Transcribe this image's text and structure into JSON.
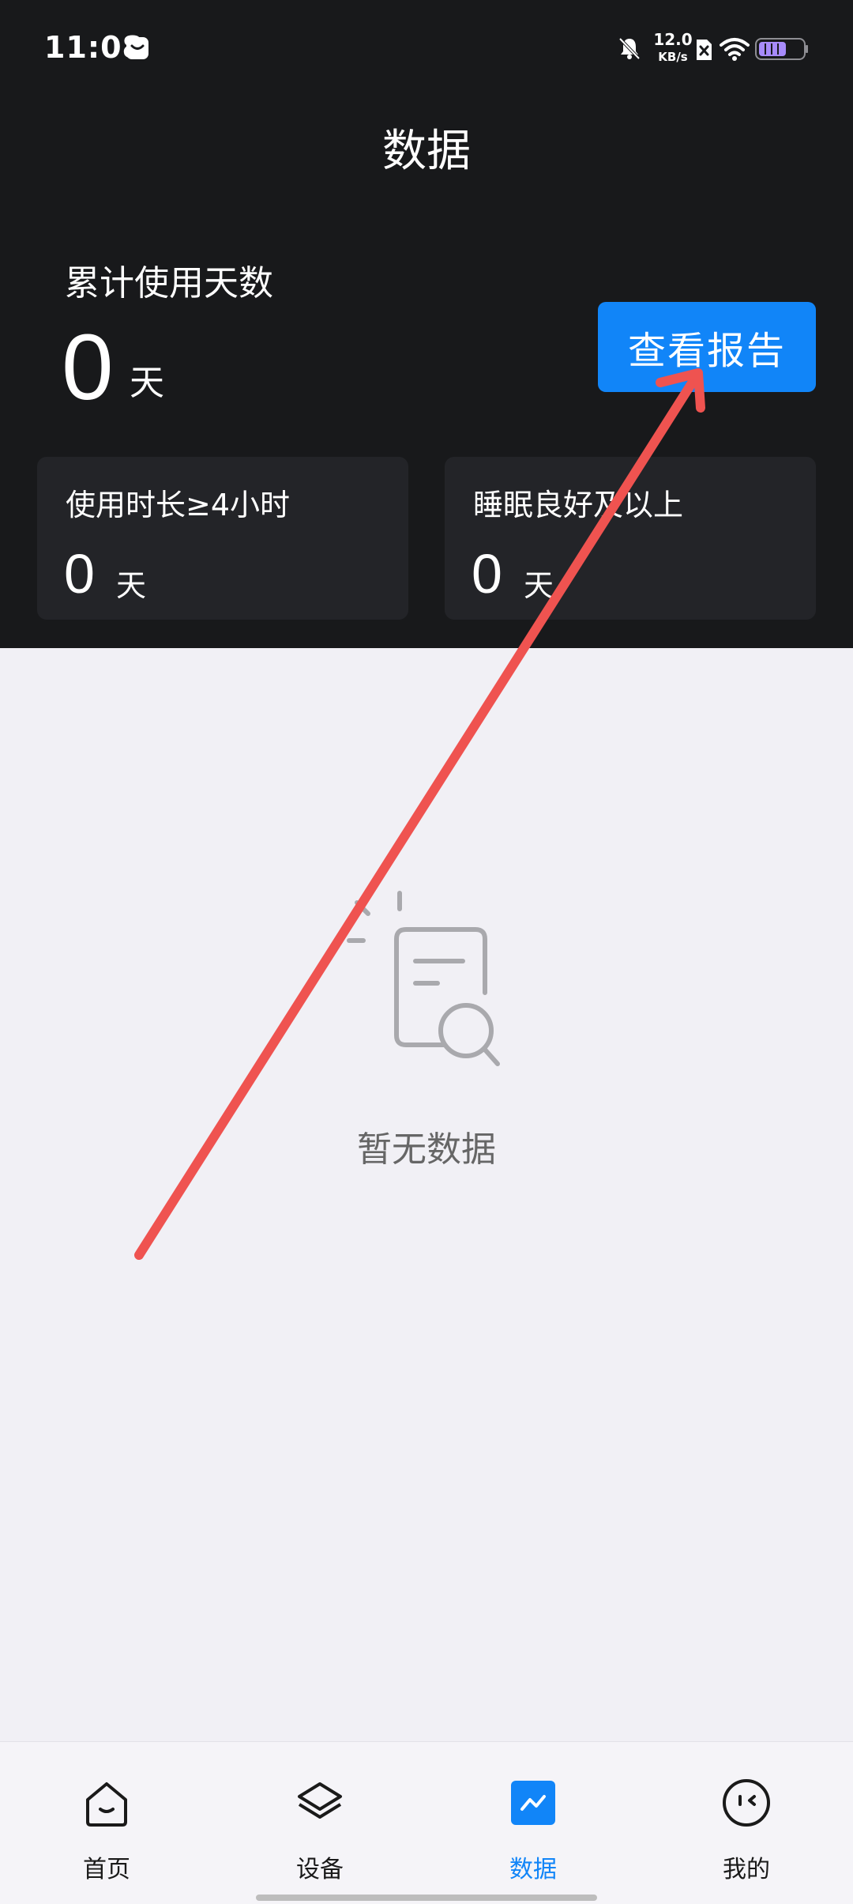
{
  "status_bar": {
    "time": "11:08",
    "net_speed_value": "12.0",
    "net_speed_unit": "KB/s",
    "icons": [
      "message-icon",
      "bell-muted-icon",
      "sim-icon",
      "wifi-icon",
      "battery-icon"
    ]
  },
  "header": {
    "title": "数据"
  },
  "summary": {
    "total_label": "累计使用天数",
    "total_value": "0",
    "total_unit": "天",
    "report_button_label": "查看报告"
  },
  "stats": [
    {
      "label": "使用时长≥4小时",
      "value": "0",
      "unit": "天"
    },
    {
      "label": "睡眠良好及以上",
      "value": "0",
      "unit": "天"
    }
  ],
  "empty_state": {
    "text": "暂无数据",
    "icon": "document-search-icon"
  },
  "nav": {
    "items": [
      {
        "label": "首页",
        "icon": "home-icon",
        "active": false
      },
      {
        "label": "设备",
        "icon": "layers-icon",
        "active": false
      },
      {
        "label": "数据",
        "icon": "chart-icon",
        "active": true
      },
      {
        "label": "我的",
        "icon": "face-icon",
        "active": false
      }
    ]
  },
  "colors": {
    "accent": "#1185f8",
    "header_bg": "#18191b",
    "card_bg": "#232428",
    "page_bg": "#f1f0f5",
    "annotation_arrow": "#ef5350"
  }
}
